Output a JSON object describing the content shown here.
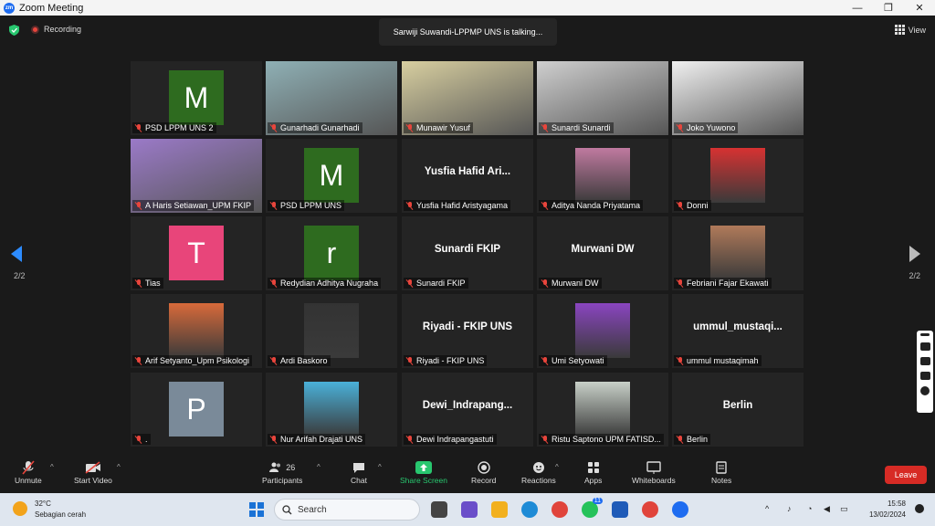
{
  "window": {
    "title": "Zoom Meeting",
    "min": "—",
    "max": "❐",
    "close": "✕"
  },
  "header": {
    "recording": "Recording",
    "talking": "Sarwiji Suwandi-LPPMP UNS is talking...",
    "view": "View",
    "page_left": "2/2",
    "page_right": "2/2"
  },
  "tiles": [
    {
      "name": "PSD LPPM UNS 2",
      "avatar": "M",
      "color": "#2e6b1f"
    },
    {
      "name": "Gunarhadi Gunarhadi"
    },
    {
      "name": "Munawir Yusuf"
    },
    {
      "name": "Sunardi Sunardi"
    },
    {
      "name": "Joko Yuwono"
    },
    {
      "name": "A Haris Setiawan_UPM FKIP"
    },
    {
      "name": "PSD LPPM UNS",
      "avatar": "M",
      "color": "#2e6b1f"
    },
    {
      "name": "Yusfia Hafid Aristyagama",
      "display": "Yusfia Hafid Ari..."
    },
    {
      "name": "Aditya Nanda Priyatama"
    },
    {
      "name": "Donni"
    },
    {
      "name": "Tias",
      "avatar": "T",
      "color": "#e8457a"
    },
    {
      "name": "Redydian Adhitya Nugraha",
      "avatar": "r",
      "color": "#2e6b1f"
    },
    {
      "name": "Sunardi FKIP",
      "display": "Sunardi FKIP"
    },
    {
      "name": "Murwani DW",
      "display": "Murwani DW"
    },
    {
      "name": "Febriani Fajar Ekawati"
    },
    {
      "name": "Arif Setyanto_Upm Psikologi"
    },
    {
      "name": "Ardi Baskoro"
    },
    {
      "name": "Riyadi - FKIP UNS",
      "display": "Riyadi - FKIP UNS"
    },
    {
      "name": "Umi Setyowati"
    },
    {
      "name": "ummul mustaqimah",
      "display": "ummul_mustaqi..."
    },
    {
      "name": ".",
      "avatar": "P",
      "color": "#7a8a99"
    },
    {
      "name": "Nur Arifah Drajati UNS"
    },
    {
      "name": "Dewi Indrapangastuti",
      "display": "Dewi_Indrapang..."
    },
    {
      "name": "Ristu Saptono UPM FATISD..."
    },
    {
      "name": "Berlin",
      "display": "Berlin"
    }
  ],
  "controls": {
    "unmute": "Unmute",
    "start_video": "Start Video",
    "participants": "Participants",
    "participants_count": "26",
    "chat": "Chat",
    "share_screen": "Share Screen",
    "record": "Record",
    "reactions": "Reactions",
    "apps": "Apps",
    "whiteboards": "Whiteboards",
    "notes": "Notes",
    "leave": "Leave"
  },
  "taskbar": {
    "temp": "32°C",
    "weather": "Sebagian cerah",
    "search": "Search",
    "time": "15:58",
    "date": "13/02/2024",
    "badge": "11"
  },
  "colors": {
    "accent": "#2d8cff",
    "leave": "#d72b25",
    "share": "#28c76f"
  }
}
